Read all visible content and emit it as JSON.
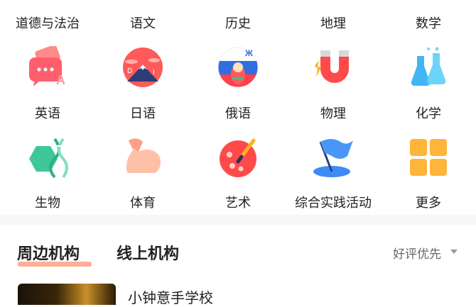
{
  "subjects": {
    "row0": [
      "道德与法治",
      "语文",
      "历史",
      "地理",
      "数学"
    ],
    "row1": [
      "英语",
      "日语",
      "俄语",
      "物理",
      "化学"
    ],
    "row2": [
      "生物",
      "体育",
      "艺术",
      "综合实践活动",
      "更多"
    ]
  },
  "icons": {
    "english": "speech-bubble-icon",
    "japanese": "mount-fuji-icon",
    "russian": "matryoshka-icon",
    "physics": "magnet-icon",
    "chemistry": "flask-icon",
    "biology": "dna-icon",
    "sports": "muscle-arm-icon",
    "art": "palette-icon",
    "practice": "flag-icon",
    "more": "grid-icon"
  },
  "tabs": {
    "nearby": "周边机构",
    "online": "线上机构"
  },
  "sort": {
    "label": "好评优先"
  },
  "listing": {
    "title": "小钟意手学校"
  },
  "colors": {
    "accent": "#ff8c6b",
    "text": "#222222",
    "muted": "#666666"
  }
}
